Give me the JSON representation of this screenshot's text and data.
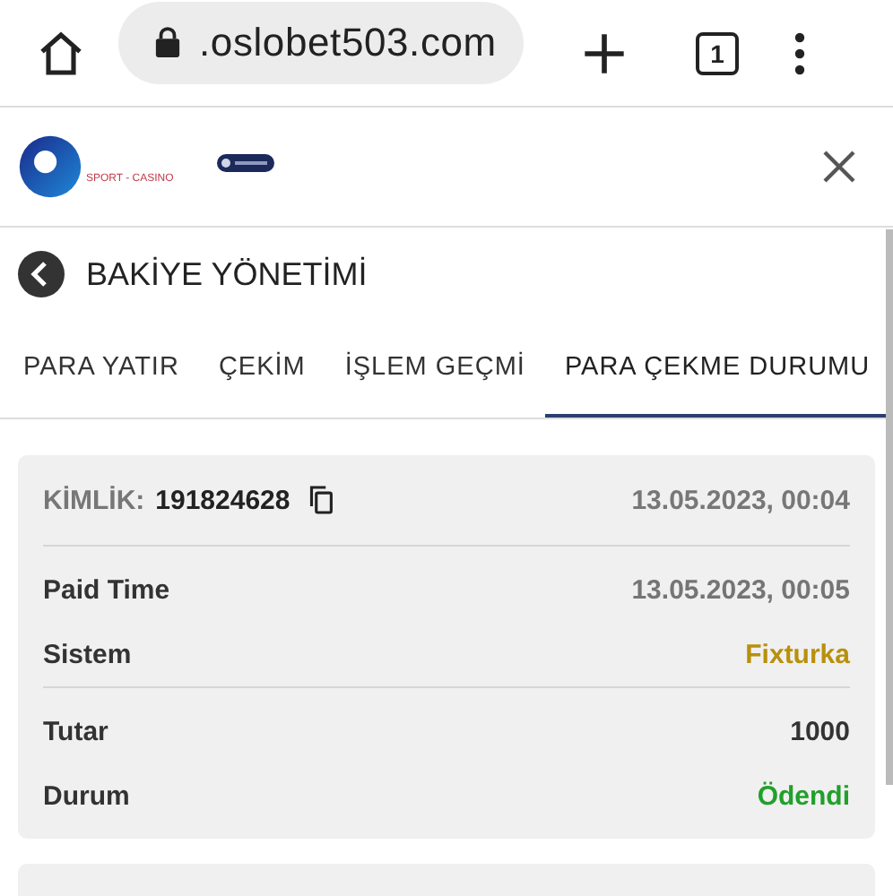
{
  "browser": {
    "url": ".oslobet503.com",
    "tab_count": "1"
  },
  "header": {
    "logo_text": "SPORT - CASINO"
  },
  "page_title": "BAKİYE YÖNETİMİ",
  "tabs": [
    {
      "label": "PARA YATIR",
      "selected": false
    },
    {
      "label": "ÇEKİM",
      "selected": false
    },
    {
      "label": "İŞLEM GEÇMİ",
      "selected": false
    },
    {
      "label": "PARA ÇEKME DURUMU",
      "selected": true
    }
  ],
  "card": {
    "id_label": "KİMLİK:",
    "id_value": "191824628",
    "date": "13.05.2023, 00:04",
    "groups": [
      [
        {
          "label": "Paid Time",
          "value": "13.05.2023, 00:05",
          "color": "#757575"
        },
        {
          "label": "Sistem",
          "value": "Fixturka",
          "color": "#b8900c"
        }
      ],
      [
        {
          "label": "Tutar",
          "value": "1000",
          "color": "#333333"
        },
        {
          "label": "Durum",
          "value": "Ödendi",
          "color": "#21a02b"
        }
      ]
    ]
  }
}
